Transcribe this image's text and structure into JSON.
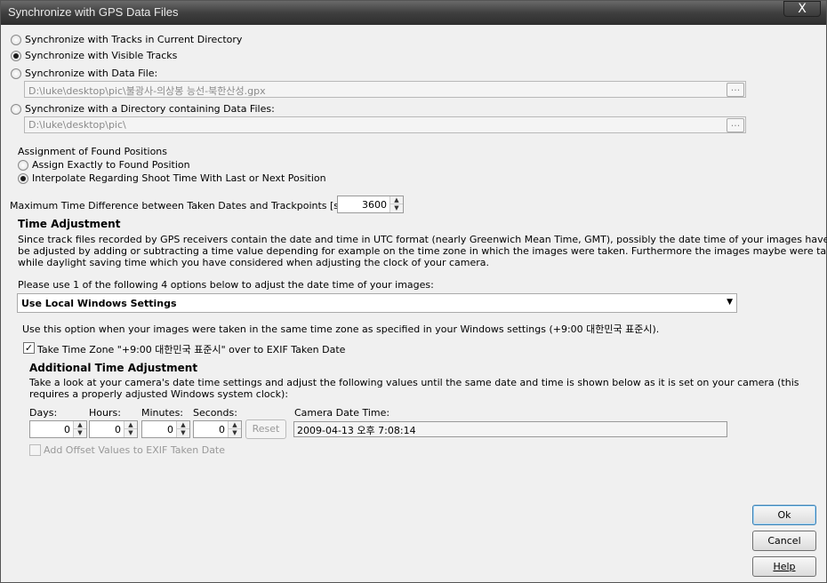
{
  "window": {
    "title": "Synchronize with GPS Data Files",
    "close_label": "X"
  },
  "sync": {
    "opt_current_dir": "Synchronize with Tracks in Current Directory",
    "opt_visible": "Synchronize with Visible Tracks",
    "opt_data_file": "Synchronize with Data File:",
    "data_file_path": "D:\\luke\\desktop\\pic\\불광사-의상봉 능선-북한산성.gpx",
    "opt_directory": "Synchronize with a Directory containing Data Files:",
    "directory_path": "D:\\luke\\desktop\\pic\\",
    "browse_label": "..."
  },
  "assignment": {
    "heading": "Assignment of Found Positions",
    "opt_exact": "Assign Exactly to Found Position",
    "opt_interpolate": "Interpolate Regarding Shoot Time With Last or Next Position"
  },
  "max_diff": {
    "label": "Maximum Time Difference between Taken Dates and Trackpoints [seconds]:",
    "value": "3600"
  },
  "time_adjustment": {
    "heading": "Time Adjustment",
    "desc1": "Since track files recorded by GPS receivers contain the date and time in UTC format (nearly Greenwich Mean Time, GMT), possibly the date time of your images have to",
    "desc2": "be adjusted by adding or subtracting a time value depending for example on the time zone in which the images were taken. Furthermore the images maybe were taken",
    "desc3": "while daylight saving time which you have considered when adjusting the clock of your camera.",
    "options_label": "Please use 1 of the following 4 options below to adjust the date time of your images:",
    "selected_option": "Use Local Windows Settings",
    "option_desc": "Use this option when your images were taken in the same time zone as specified in your Windows settings (+9:00 대한민국 표준시).",
    "take_tz_label": "Take Time Zone \"+9:00 대한민국 표준시\" over to EXIF Taken Date"
  },
  "additional": {
    "heading": "Additional Time Adjustment",
    "desc1": "Take a look at your camera's date time settings and adjust the following values until the same date and time is shown below as it is  set on your camera (this",
    "desc2": "requires a properly adjusted Windows system clock):",
    "days_label": "Days:",
    "days_value": "0",
    "hours_label": "Hours:",
    "hours_value": "0",
    "minutes_label": "Minutes:",
    "minutes_value": "0",
    "seconds_label": "Seconds:",
    "seconds_value": "0",
    "reset_label": "Reset",
    "camera_label": "Camera Date Time:",
    "camera_value": "2009-04-13 오후 7:08:14",
    "add_offset_label": "Add Offset Values to EXIF Taken Date"
  },
  "buttons": {
    "ok": "Ok",
    "cancel": "Cancel",
    "help": "Help"
  }
}
